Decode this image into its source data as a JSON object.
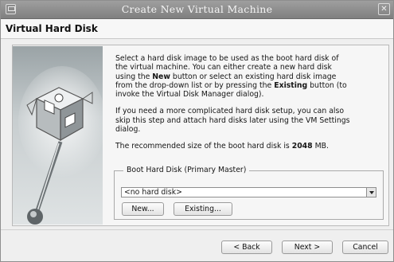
{
  "window": {
    "title": "Create New Virtual Machine"
  },
  "header": {
    "title": "Virtual Hard Disk"
  },
  "content": {
    "para1": [
      "Select a hard disk image to be used as the boot hard disk of",
      "the virtual machine. You can either create a new hard disk",
      "using the ",
      "New",
      " button or select an existing hard disk image",
      "from the drop-down list or by pressing the ",
      "Existing",
      " button (to",
      "invoke the Virtual Disk Manager dialog)."
    ],
    "para2": [
      "If you need a more complicated hard disk setup, you can also",
      "skip this step and attach hard disks later using the VM Settings",
      "dialog."
    ],
    "para3": {
      "prefix": "The recommended size of the boot hard disk is ",
      "size": "2048",
      "unit": " MB."
    }
  },
  "boot_group": {
    "legend": "Boot Hard Disk (Primary Master)",
    "combo_value": "<no hard disk>",
    "new_button": "New...",
    "existing_button": "Existing..."
  },
  "footer": {
    "back_button": "< Back",
    "next_button": "Next >",
    "cancel_button": "Cancel"
  }
}
